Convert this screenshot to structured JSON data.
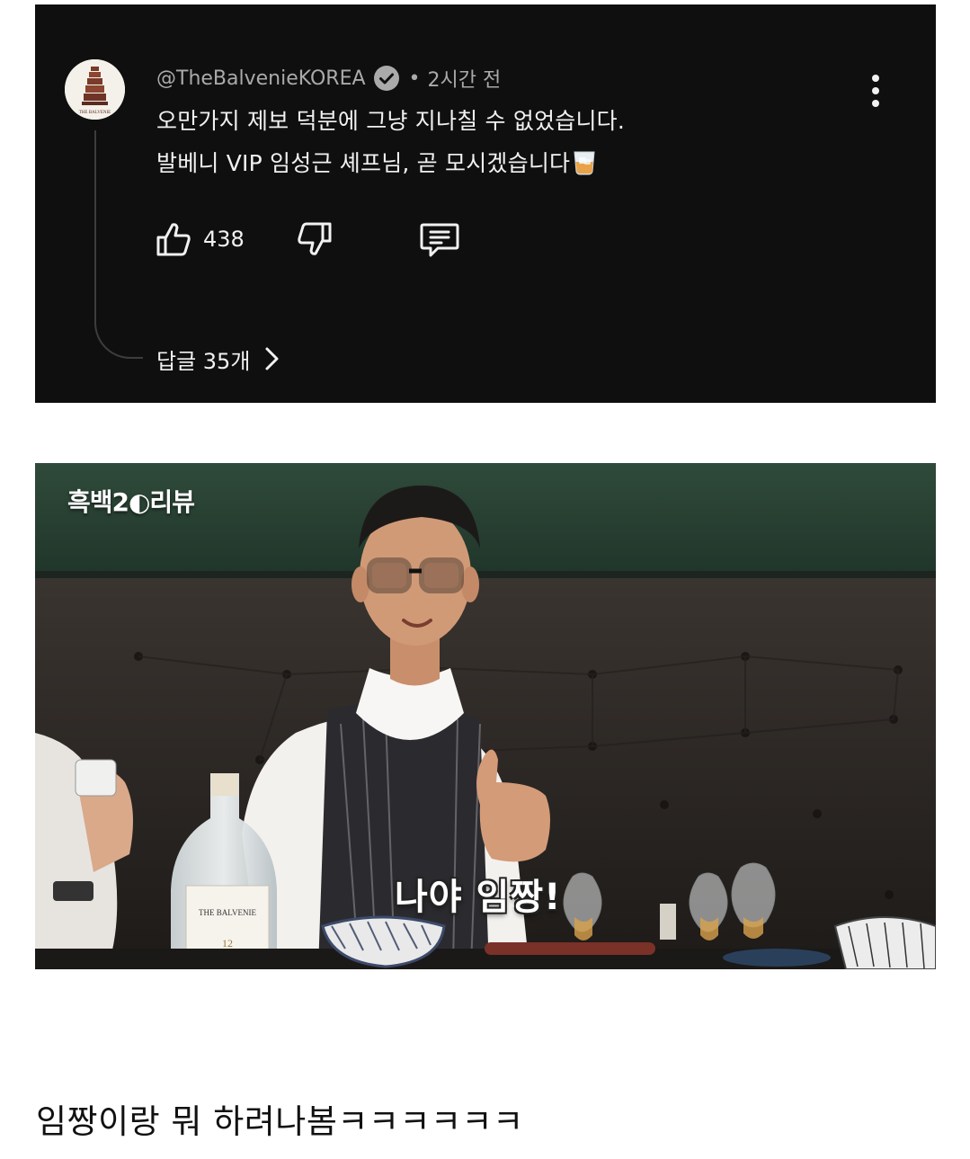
{
  "comment": {
    "avatar_text": "THE BALVENIE",
    "handle": "@TheBalvenieKOREA",
    "separator": "•",
    "time": "2시간 전",
    "lines": [
      "오만가지 제보 덕분에 그냥 지나칠 수 없었습니다.",
      "발베니 VIP 임성근 셰프님, 곧 모시겠습니다"
    ],
    "emoji_icon": "whisky-glass-icon",
    "like_count": "438",
    "replies_label": "답글 35개"
  },
  "video": {
    "logo": "흑백2◐리뷰",
    "subtitle": "나야 임짱!",
    "bottle_label": "THE BALVENIE"
  },
  "caption": "임짱이랑 뭐 하려나봄ㅋㅋㅋㅋㅋㅋ",
  "colors": {
    "card_bg": "#0f0f0f",
    "text_primary": "#f1f1f1",
    "text_secondary": "#aaaaaa"
  }
}
